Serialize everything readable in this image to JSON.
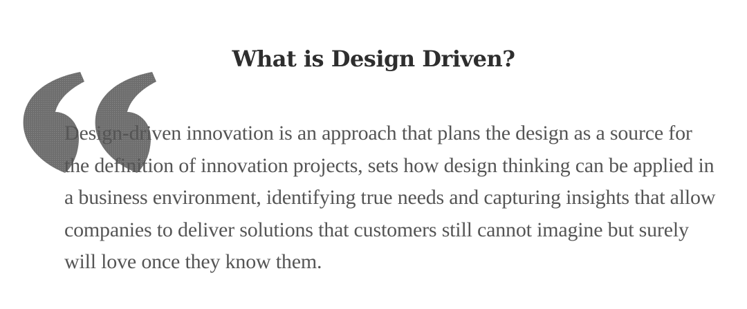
{
  "section": {
    "title": "What is Design Driven?",
    "body": "Design-driven innovation is an approach that plans the design as a source for the definition of innovation projects, sets how design thinking can be applied in a business environment, identifying true needs and capturing insights that allow companies to deliver solutions that customers still cannot imagine but surely will love once they know them."
  },
  "decoration": {
    "quote_icon": "open-quote-icon",
    "quote_color": "#6b6b6b"
  }
}
